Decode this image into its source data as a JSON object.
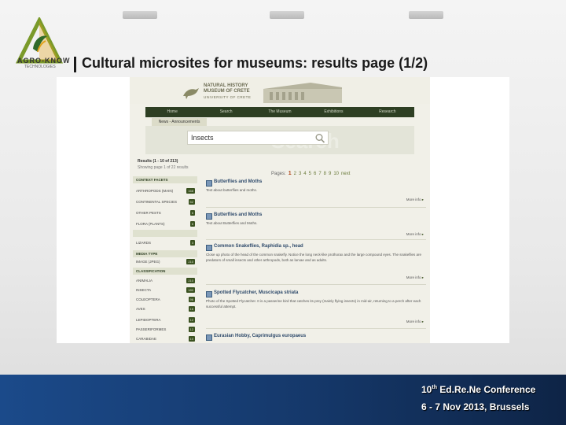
{
  "slide": {
    "title": "Cultural microsites for museums: results page (1/2)",
    "logo_text": "AGRO-KNOW",
    "logo_sub": "TECHNOLOGIES",
    "footer_line1_a": "10",
    "footer_line1_sup": "th",
    "footer_line1_b": " Ed.Re.Ne Conference",
    "footer_line2": "6 - 7 Nov 2013, Brussels"
  },
  "site": {
    "name_line1": "NATURAL HISTORY",
    "name_line2": "MUSEUM OF CRETE",
    "name_line3": "UNIVERSITY OF CRETE",
    "nav": [
      "Home",
      "Search",
      "The Museum",
      "Exhibitions",
      "Research"
    ],
    "subnav": "News - Announcements",
    "search_watermark": "Search",
    "search_value": "Insects"
  },
  "results": {
    "summary": "Results (1 - 10 of 213)",
    "subline": "Showing page 1 of 22 results",
    "pager_label": "Pages:",
    "pages": [
      "1",
      "2",
      "3",
      "4",
      "5",
      "6",
      "7",
      "8",
      "9",
      "10"
    ],
    "next_label": "next",
    "items": [
      {
        "title": "Butterflies and Moths",
        "desc": "Text about butterflies and moths.",
        "more": "More info"
      },
      {
        "title": "Butterflies and Moths",
        "desc": "Text about Butterflies and Moths.",
        "more": "More info"
      },
      {
        "title": "Common Snakeflies, Raphidia sp., head",
        "desc": "Close up photo of the head of the common snakefly. Notice the long neck-like prothorax and the large compound eyes. The snakeflies are predators of small insects and other arthropods, both as larvae and as adults.",
        "more": "More info"
      },
      {
        "title": "Spotted Flycatcher, Muscicapa striata",
        "desc": "Photo of the Spotted Flycatcher. It is a passerine bird that catches its prey (mainly flying insects) in mid-air, returning to a perch after each successful attempt.",
        "more": "More info"
      },
      {
        "title": "Eurasian Hobby, Caprimulgus europaeus",
        "desc": "",
        "more": ""
      }
    ]
  },
  "facets": [
    {
      "label": "CONTEXT FACETS",
      "count": "",
      "header": true
    },
    {
      "label": "ARTHROPODS (MAIN)",
      "count": "168",
      "header": false
    },
    {
      "label": "CONTINENTAL SPECIES",
      "count": "52",
      "header": false
    },
    {
      "label": "OTHER PESTS",
      "count": "6",
      "header": false
    },
    {
      "label": "FLORA (PLANTS)",
      "count": "6",
      "header": false
    },
    {
      "label": "",
      "count": "",
      "header": true
    },
    {
      "label": "LIZARDS",
      "count": "3",
      "header": false
    },
    {
      "label": "MEDIA TYPE",
      "count": "",
      "header": true
    },
    {
      "label": "IMAGE (JPEG)",
      "count": "210",
      "header": false
    },
    {
      "label": "CLASSIFICATION",
      "count": "",
      "header": true
    },
    {
      "label": "ANIMALIA",
      "count": "210",
      "header": false
    },
    {
      "label": "INSECTA",
      "count": "180",
      "header": false
    },
    {
      "label": "COLEOPTERA",
      "count": "96",
      "header": false
    },
    {
      "label": "AVES",
      "count": "16",
      "header": false
    },
    {
      "label": "LEPIDOPTERA",
      "count": "12",
      "header": false
    },
    {
      "label": "PASSERIFORMES",
      "count": "12",
      "header": false
    },
    {
      "label": "CARABIDAE",
      "count": "10",
      "header": false
    }
  ]
}
